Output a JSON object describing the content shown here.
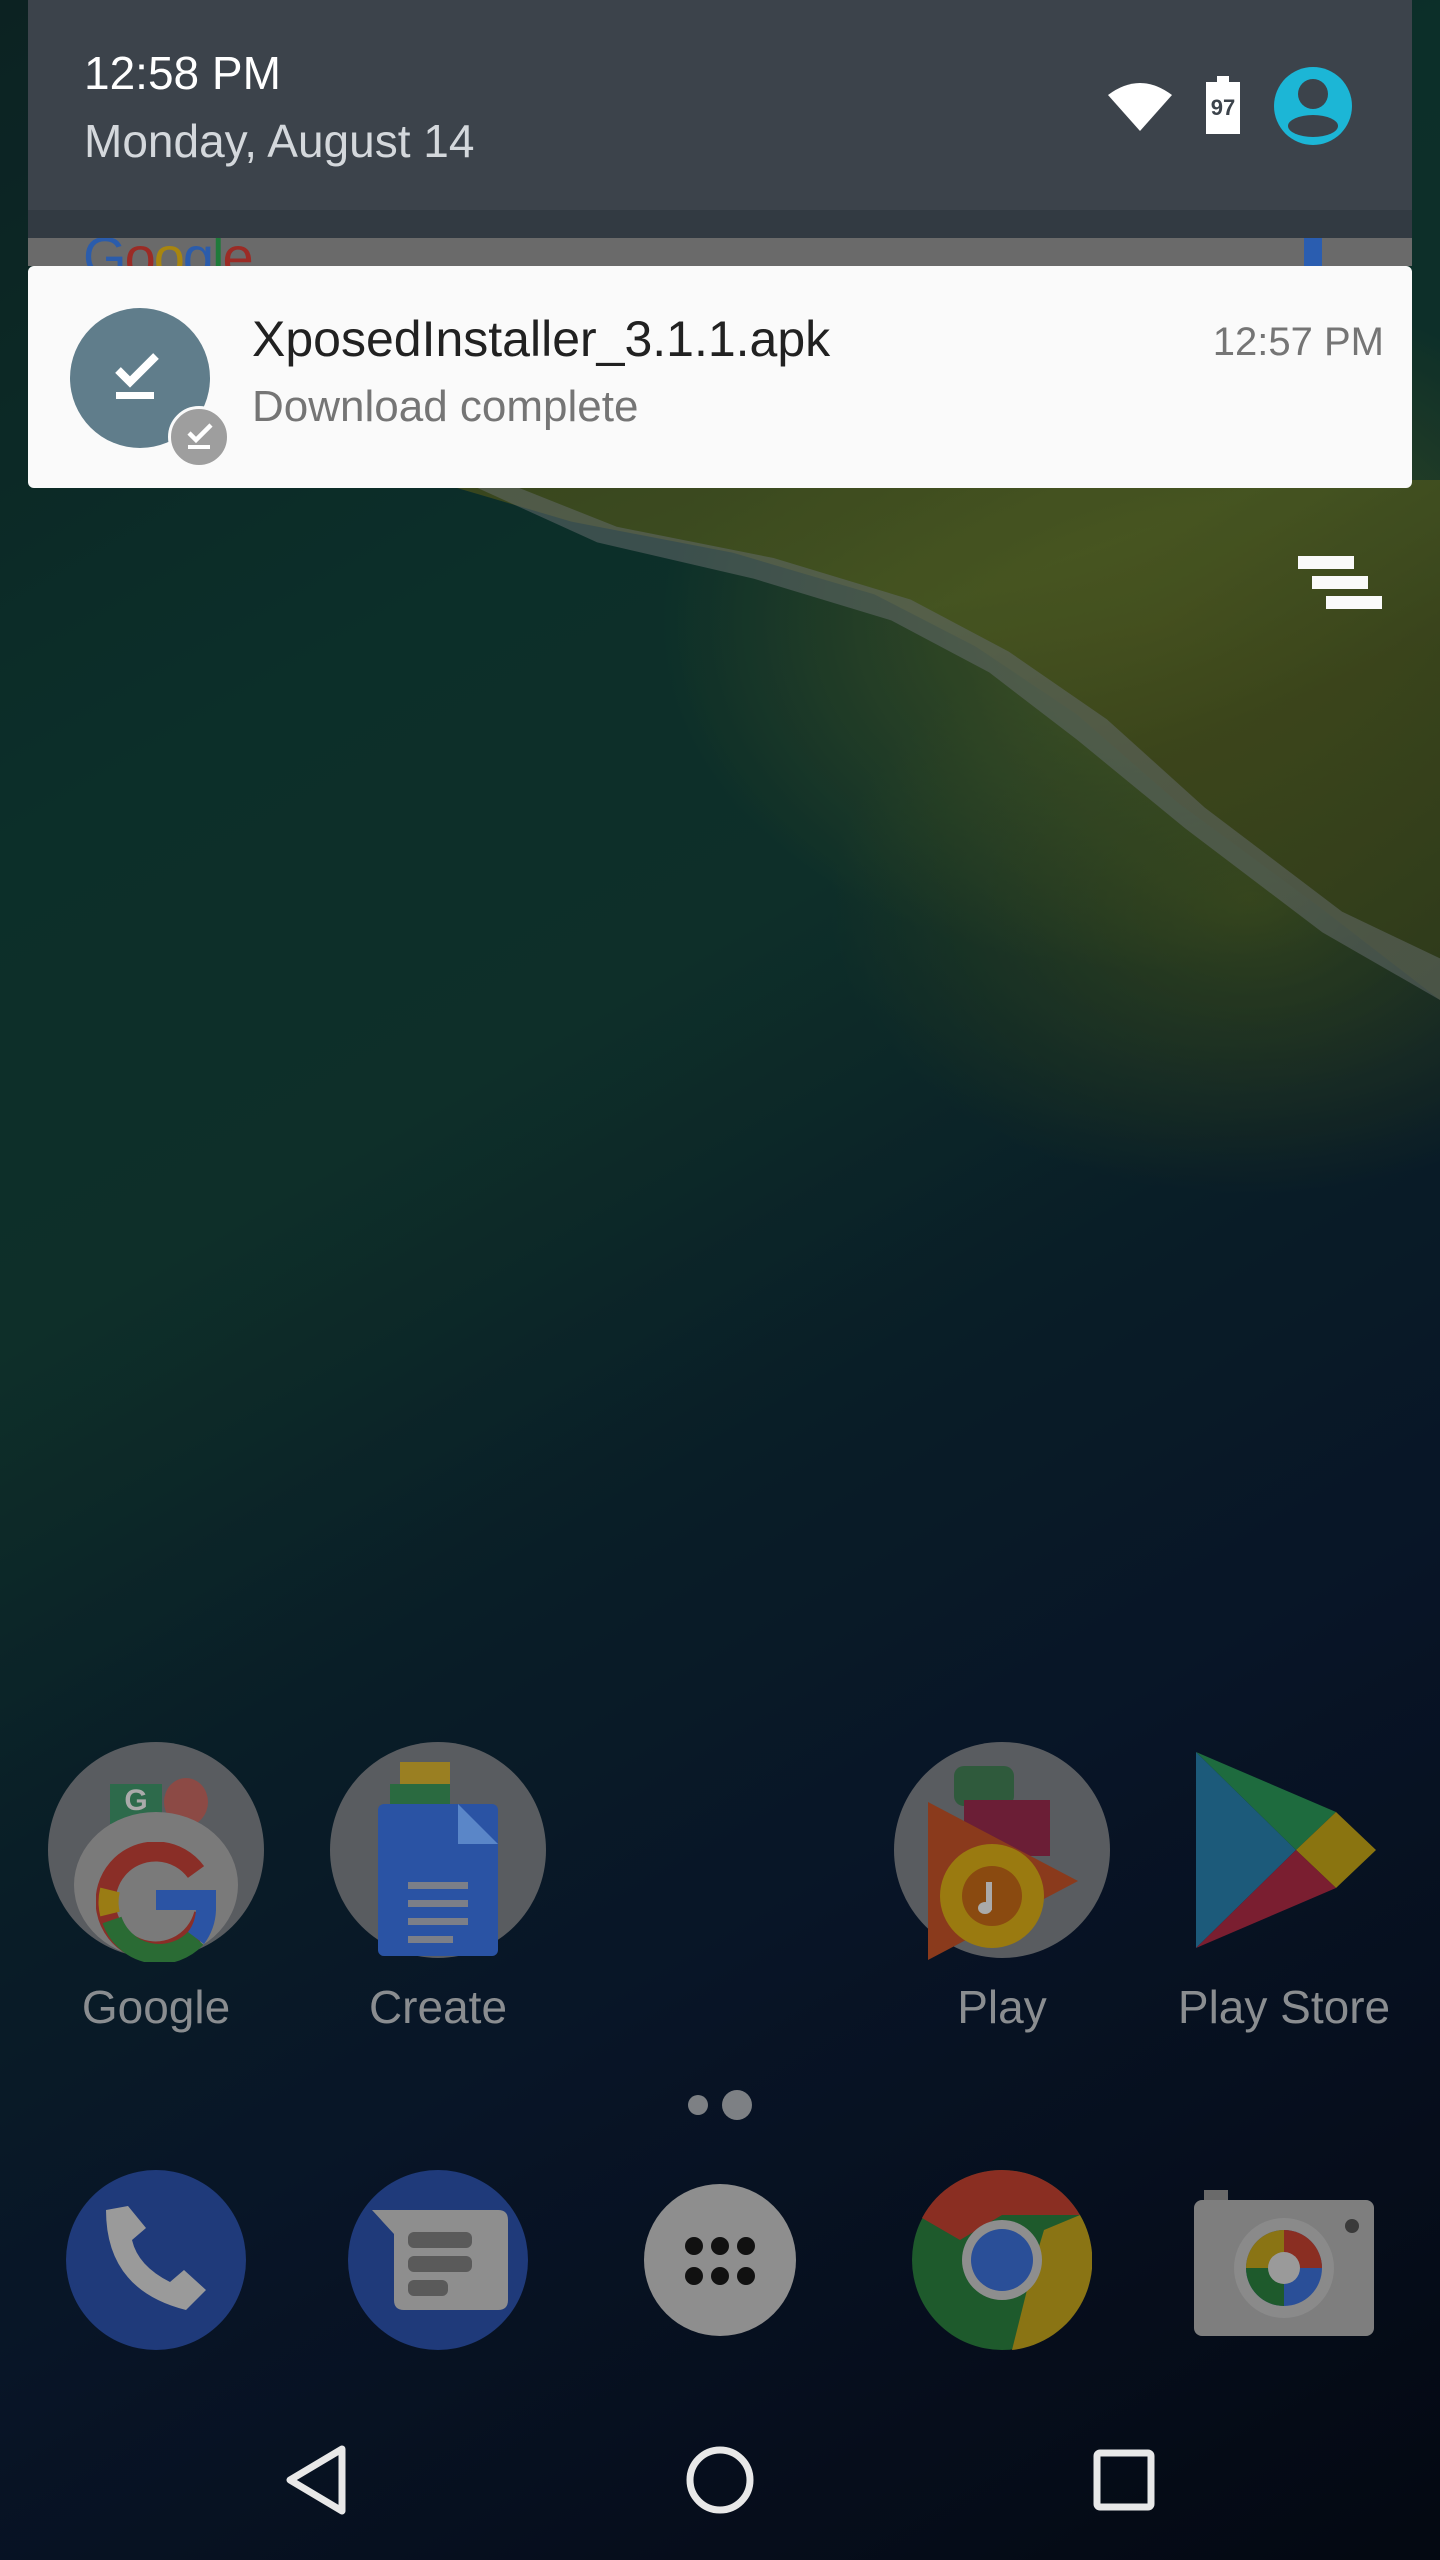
{
  "status_bar": {
    "time": "12:58 PM",
    "date": "Monday, August 14",
    "battery_level": "97",
    "icons": [
      "wifi-icon",
      "battery-icon",
      "account-avatar-icon"
    ]
  },
  "search_widget": {
    "logo_text": "Google"
  },
  "notification": {
    "title": "XposedInstaller_3.1.1.apk",
    "text": "Download complete",
    "time": "12:57 PM",
    "icon": "download-done-icon",
    "icon_color": "#607d8b",
    "badge_color": "#9e9e9e"
  },
  "home_apps": [
    {
      "label": "Google",
      "icon": "google-folder-icon"
    },
    {
      "label": "Create",
      "icon": "docs-folder-icon"
    },
    {
      "label": "Play",
      "icon": "play-folder-icon"
    },
    {
      "label": "Play Store",
      "icon": "play-store-icon"
    }
  ],
  "page_indicator": {
    "pages": 2,
    "current": 2
  },
  "dock": [
    {
      "name": "Phone",
      "icon": "phone-icon"
    },
    {
      "name": "Messages",
      "icon": "messages-icon"
    },
    {
      "name": "App drawer",
      "icon": "app-drawer-icon"
    },
    {
      "name": "Chrome",
      "icon": "chrome-icon"
    },
    {
      "name": "Camera",
      "icon": "camera-icon"
    }
  ],
  "nav": {
    "back": "back-icon",
    "home": "home-icon",
    "recents": "recents-icon"
  },
  "colors": {
    "shade_bg": "#3c434b",
    "accent_avatar": "#1cb6d6",
    "notification_bg": "#fafafa"
  }
}
